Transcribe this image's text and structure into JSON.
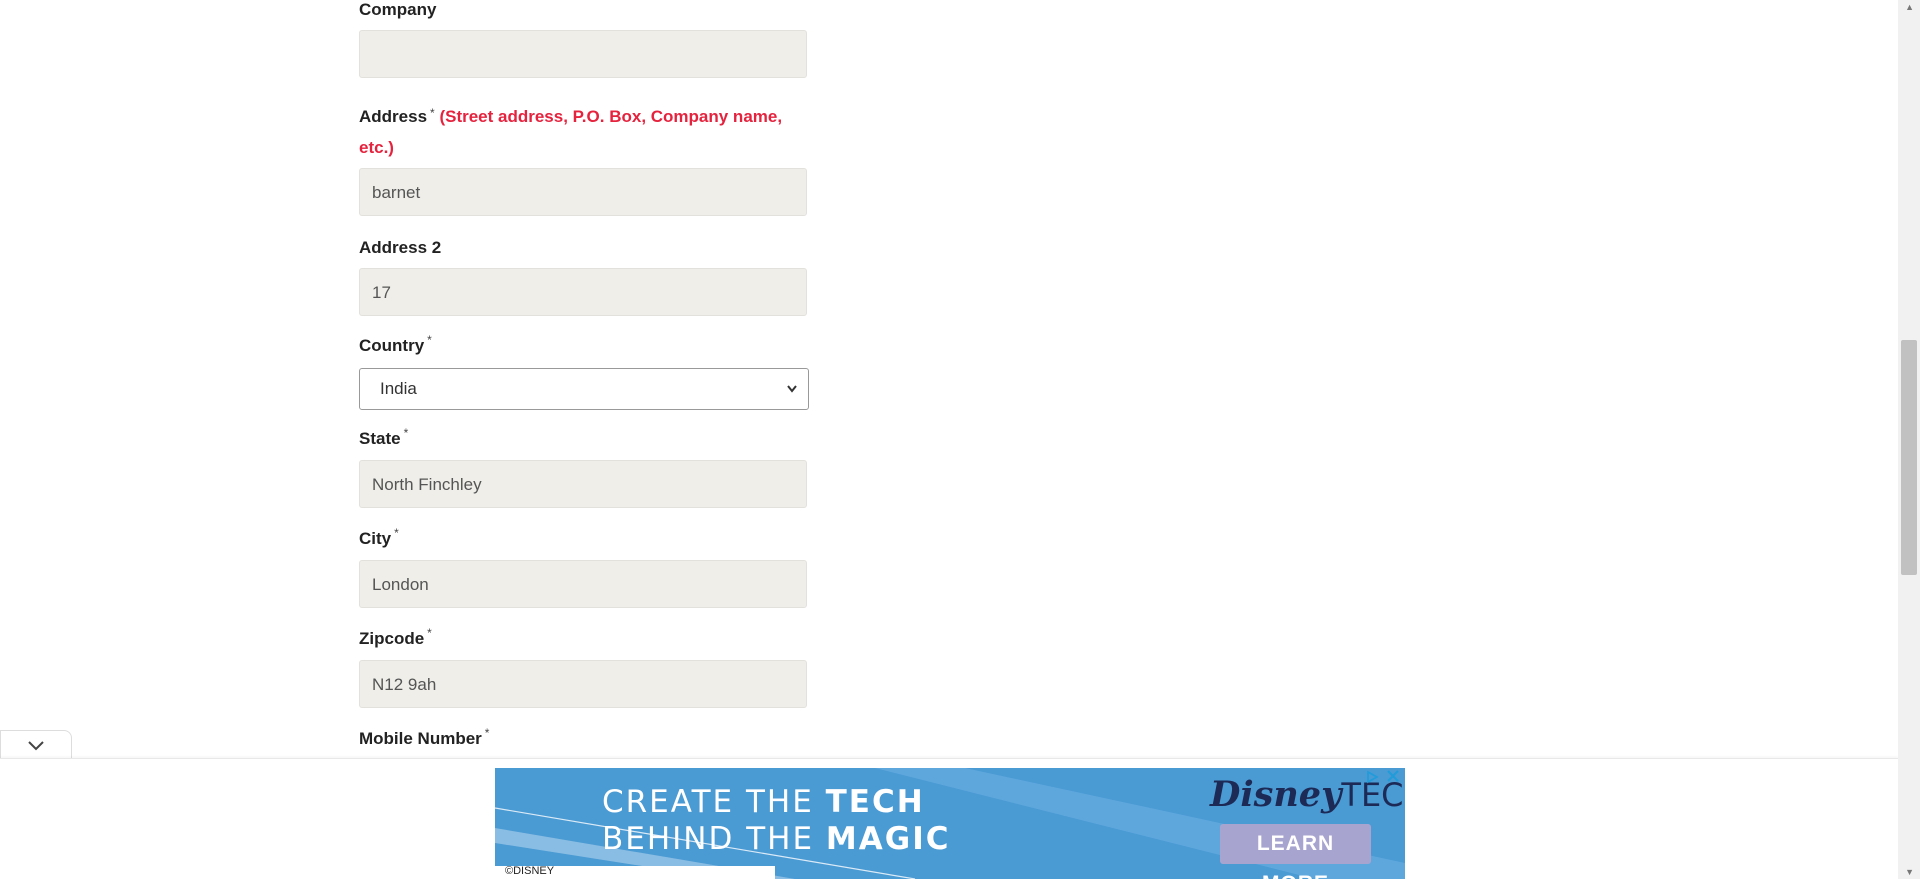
{
  "form": {
    "company": {
      "label": "Company",
      "value": ""
    },
    "address": {
      "label": "Address",
      "required": "*",
      "hint": "(Street address, P.O. Box, Company name,",
      "hint2": "etc.)",
      "value": "barnet"
    },
    "address2": {
      "label": "Address 2",
      "value": "17"
    },
    "country": {
      "label": "Country",
      "required": "*",
      "value": "India"
    },
    "state": {
      "label": "State",
      "required": "*",
      "value": "North Finchley"
    },
    "city": {
      "label": "City",
      "required": "*",
      "value": "London"
    },
    "zipcode": {
      "label": "Zipcode",
      "required": "*",
      "value": "N12 9ah"
    },
    "mobile": {
      "label": "Mobile Number",
      "required": "*"
    }
  },
  "ad": {
    "line1_a": "CREATE THE ",
    "line1_b": "TECH",
    "line2_a": "BEHIND THE ",
    "line2_b": "MAGIC",
    "brand": "Disney",
    "brand_suffix": "TECH",
    "cta": "LEARN MORE",
    "copyright": "©DISNEY"
  },
  "colors": {
    "hint": "#e5233e",
    "input_bg": "#efeee9",
    "ad_bg": "#4a9ad4",
    "ad_cta": "#a7a5cf"
  },
  "icons": {
    "collapse": "chevron-down-icon",
    "ad_choices": "ad-choices-icon",
    "ad_close": "close-icon"
  }
}
